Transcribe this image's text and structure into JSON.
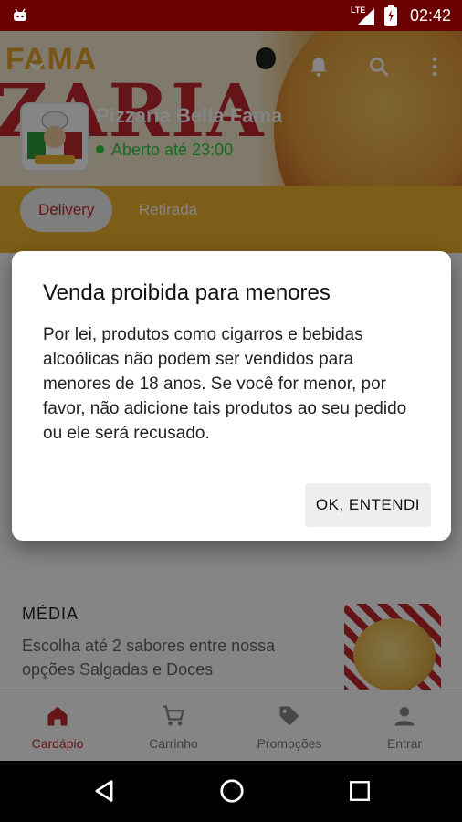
{
  "status_bar": {
    "network": "LTE",
    "time": "02:42"
  },
  "restaurant": {
    "banner_top": "FAMA",
    "banner_main": "ZARIA",
    "name": "Pizzaria Bella Fama",
    "status": "Aberto até 23:00"
  },
  "order_type": {
    "options": [
      "Delivery",
      "Retirada"
    ],
    "selected": "Delivery"
  },
  "section": {
    "title": "MÉDIA",
    "description": "Escolha até 2 sabores entre nossa opções Salgadas e Doces"
  },
  "bottom_nav": {
    "items": [
      {
        "label": "Cardápio",
        "icon": "home-icon"
      },
      {
        "label": "Carrinho",
        "icon": "cart-icon"
      },
      {
        "label": "Promoções",
        "icon": "tag-icon"
      },
      {
        "label": "Entrar",
        "icon": "person-icon"
      }
    ],
    "active": "Cardápio"
  },
  "dialog": {
    "title": "Venda proibida para menores",
    "body": "Por lei, produtos como cigarros e bebidas alcoólicas não podem ser vendidos para menores de 18 anos. Se você for menor, por favor, não adicione tais produtos ao seu pedido ou ele será recusado.",
    "confirm_label": "OK, ENTENDI"
  },
  "colors": {
    "accent": "#c1272d",
    "status_bar": "#6b0000",
    "open": "#2ecc40"
  }
}
